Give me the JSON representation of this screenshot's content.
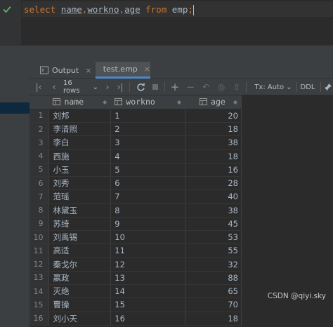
{
  "editor": {
    "keyword_select": "select",
    "col1": "name",
    "comma1": ",",
    "col2": "workno",
    "comma2": ",",
    "col3": "age",
    "keyword_from": "from",
    "table": "emp",
    "semicolon": ";"
  },
  "tabs": [
    {
      "label": "Output",
      "close": "×"
    },
    {
      "label": "test.emp",
      "close": "×"
    }
  ],
  "toolbar": {
    "rows": "16 rows",
    "rows_arrow": "⌄",
    "tx": "Tx: Auto",
    "tx_arrow": "⌄",
    "ddl": "DDL"
  },
  "grid": {
    "columns": [
      "name",
      "workno",
      "age"
    ],
    "rows": [
      [
        "1",
        "刘邦",
        "1",
        "20"
      ],
      [
        "2",
        "李清照",
        "2",
        "18"
      ],
      [
        "3",
        "李白",
        "3",
        "38"
      ],
      [
        "4",
        "西施",
        "4",
        "18"
      ],
      [
        "5",
        "小玉",
        "5",
        "16"
      ],
      [
        "6",
        "刘秀",
        "6",
        "28"
      ],
      [
        "7",
        "范瑶",
        "7",
        "40"
      ],
      [
        "8",
        "林黛玉",
        "8",
        "38"
      ],
      [
        "9",
        "苏绮",
        "9",
        "45"
      ],
      [
        "10",
        "刘禹锡",
        "10",
        "53"
      ],
      [
        "11",
        "高适",
        "11",
        "55"
      ],
      [
        "12",
        "秦戈尔",
        "12",
        "32"
      ],
      [
        "13",
        "嬴政",
        "13",
        "88"
      ],
      [
        "14",
        "灭绝",
        "14",
        "65"
      ],
      [
        "15",
        "曹操",
        "15",
        "70"
      ],
      [
        "16",
        "刘小天",
        "16",
        "18"
      ]
    ]
  },
  "watermark": "CSDN @qiyi.sky",
  "colors": {
    "keyword": "#cc7832",
    "accent": "#4a88c7",
    "check": "#59a869"
  }
}
